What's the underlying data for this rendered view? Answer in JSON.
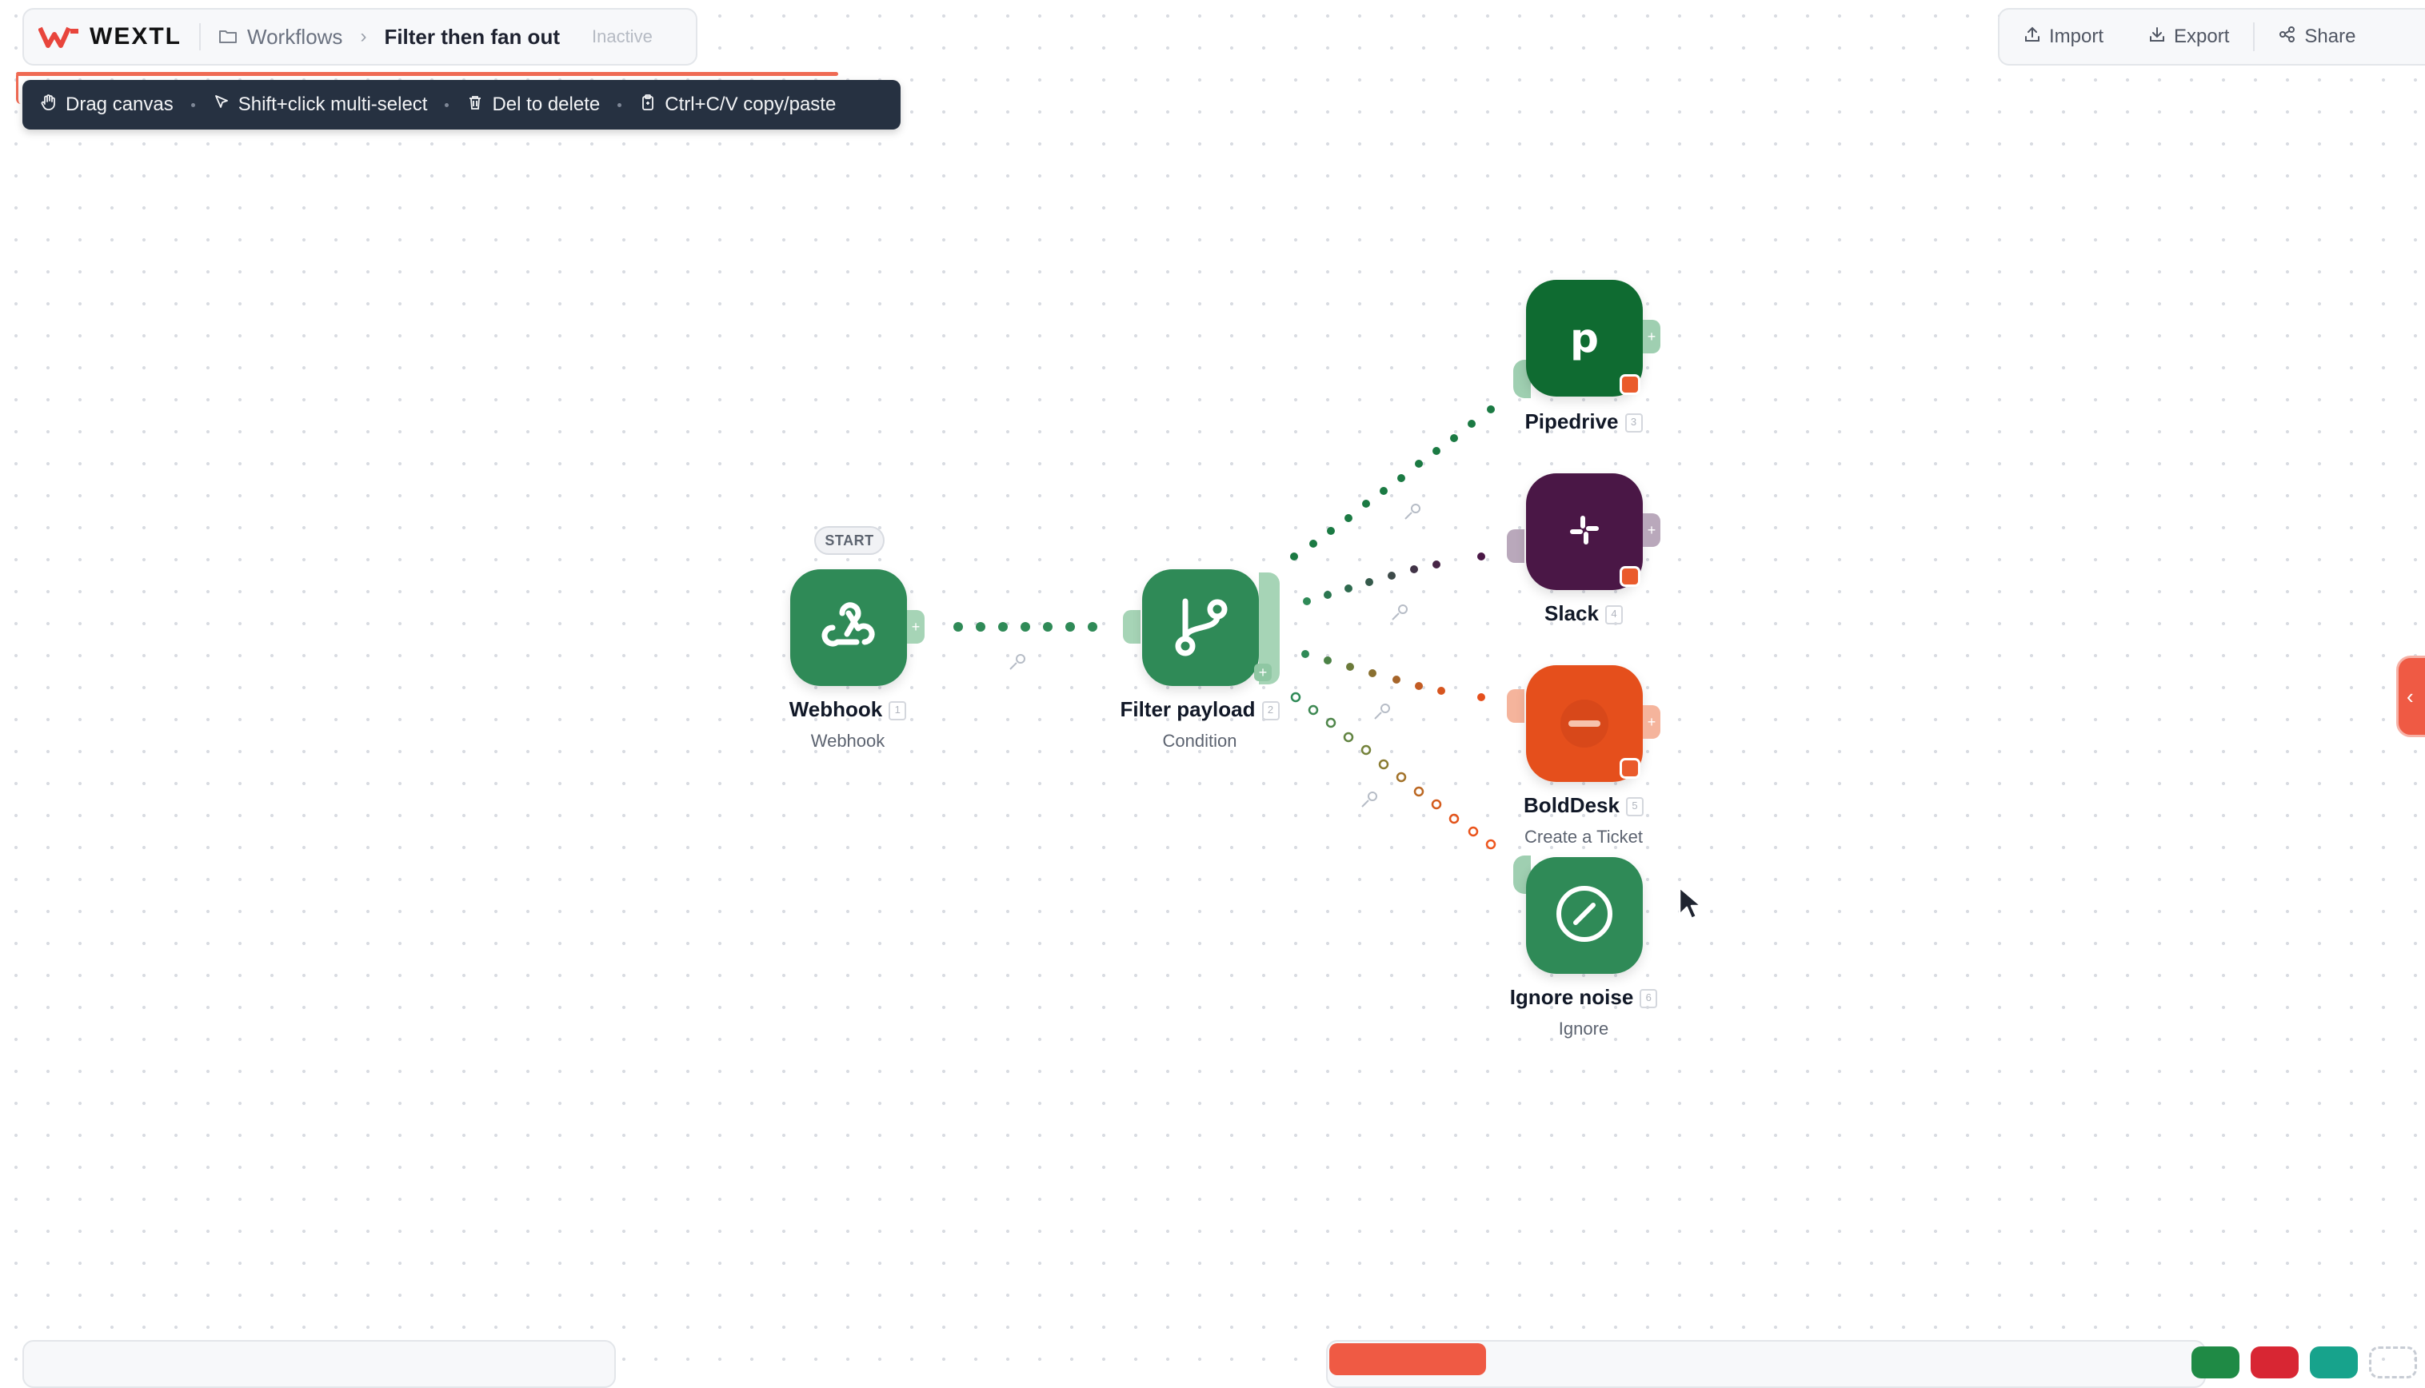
{
  "header": {
    "brand": "WEXTL",
    "breadcrumb_root": "Workflows",
    "workflow_title": "Filter then fan out",
    "status": "Inactive"
  },
  "hints": {
    "drag": "Drag canvas",
    "multiselect": "Shift+click multi-select",
    "delete": "Del to delete",
    "copy": "Ctrl+C/V copy/paste"
  },
  "actions": {
    "import": "Import",
    "export": "Export",
    "share": "Share"
  },
  "nodes": {
    "start_label": "START",
    "webhook": {
      "title": "Webhook",
      "subtitle": "Webhook",
      "index": "1",
      "color": "#2f8a57"
    },
    "filter": {
      "title": "Filter payload",
      "subtitle": "Condition",
      "index": "2",
      "color": "#2f8a57"
    },
    "pipedrive": {
      "title": "Pipedrive",
      "index": "3",
      "color": "#0f6b31"
    },
    "slack": {
      "title": "Slack",
      "index": "4",
      "color": "#4a1746"
    },
    "bolddesk": {
      "title": "BoldDesk",
      "subtitle": "Create a Ticket",
      "index": "5",
      "color": "#e54f1c"
    },
    "ignore": {
      "title": "Ignore noise",
      "subtitle": "Ignore",
      "index": "6",
      "color": "#2f8a57"
    }
  },
  "colors": {
    "accent": "#ef5a44",
    "canvas_dots": "#d9dce2",
    "hint_bar": "#263141"
  },
  "icons": {
    "logo": "wextl-logo-icon",
    "folder": "folder-icon",
    "hand": "hand-icon",
    "pointer": "cursor-pointer-icon",
    "trash": "trash-icon",
    "clipboard": "clipboard-icon",
    "upload": "upload-icon",
    "download": "download-icon",
    "share": "share-icon"
  }
}
